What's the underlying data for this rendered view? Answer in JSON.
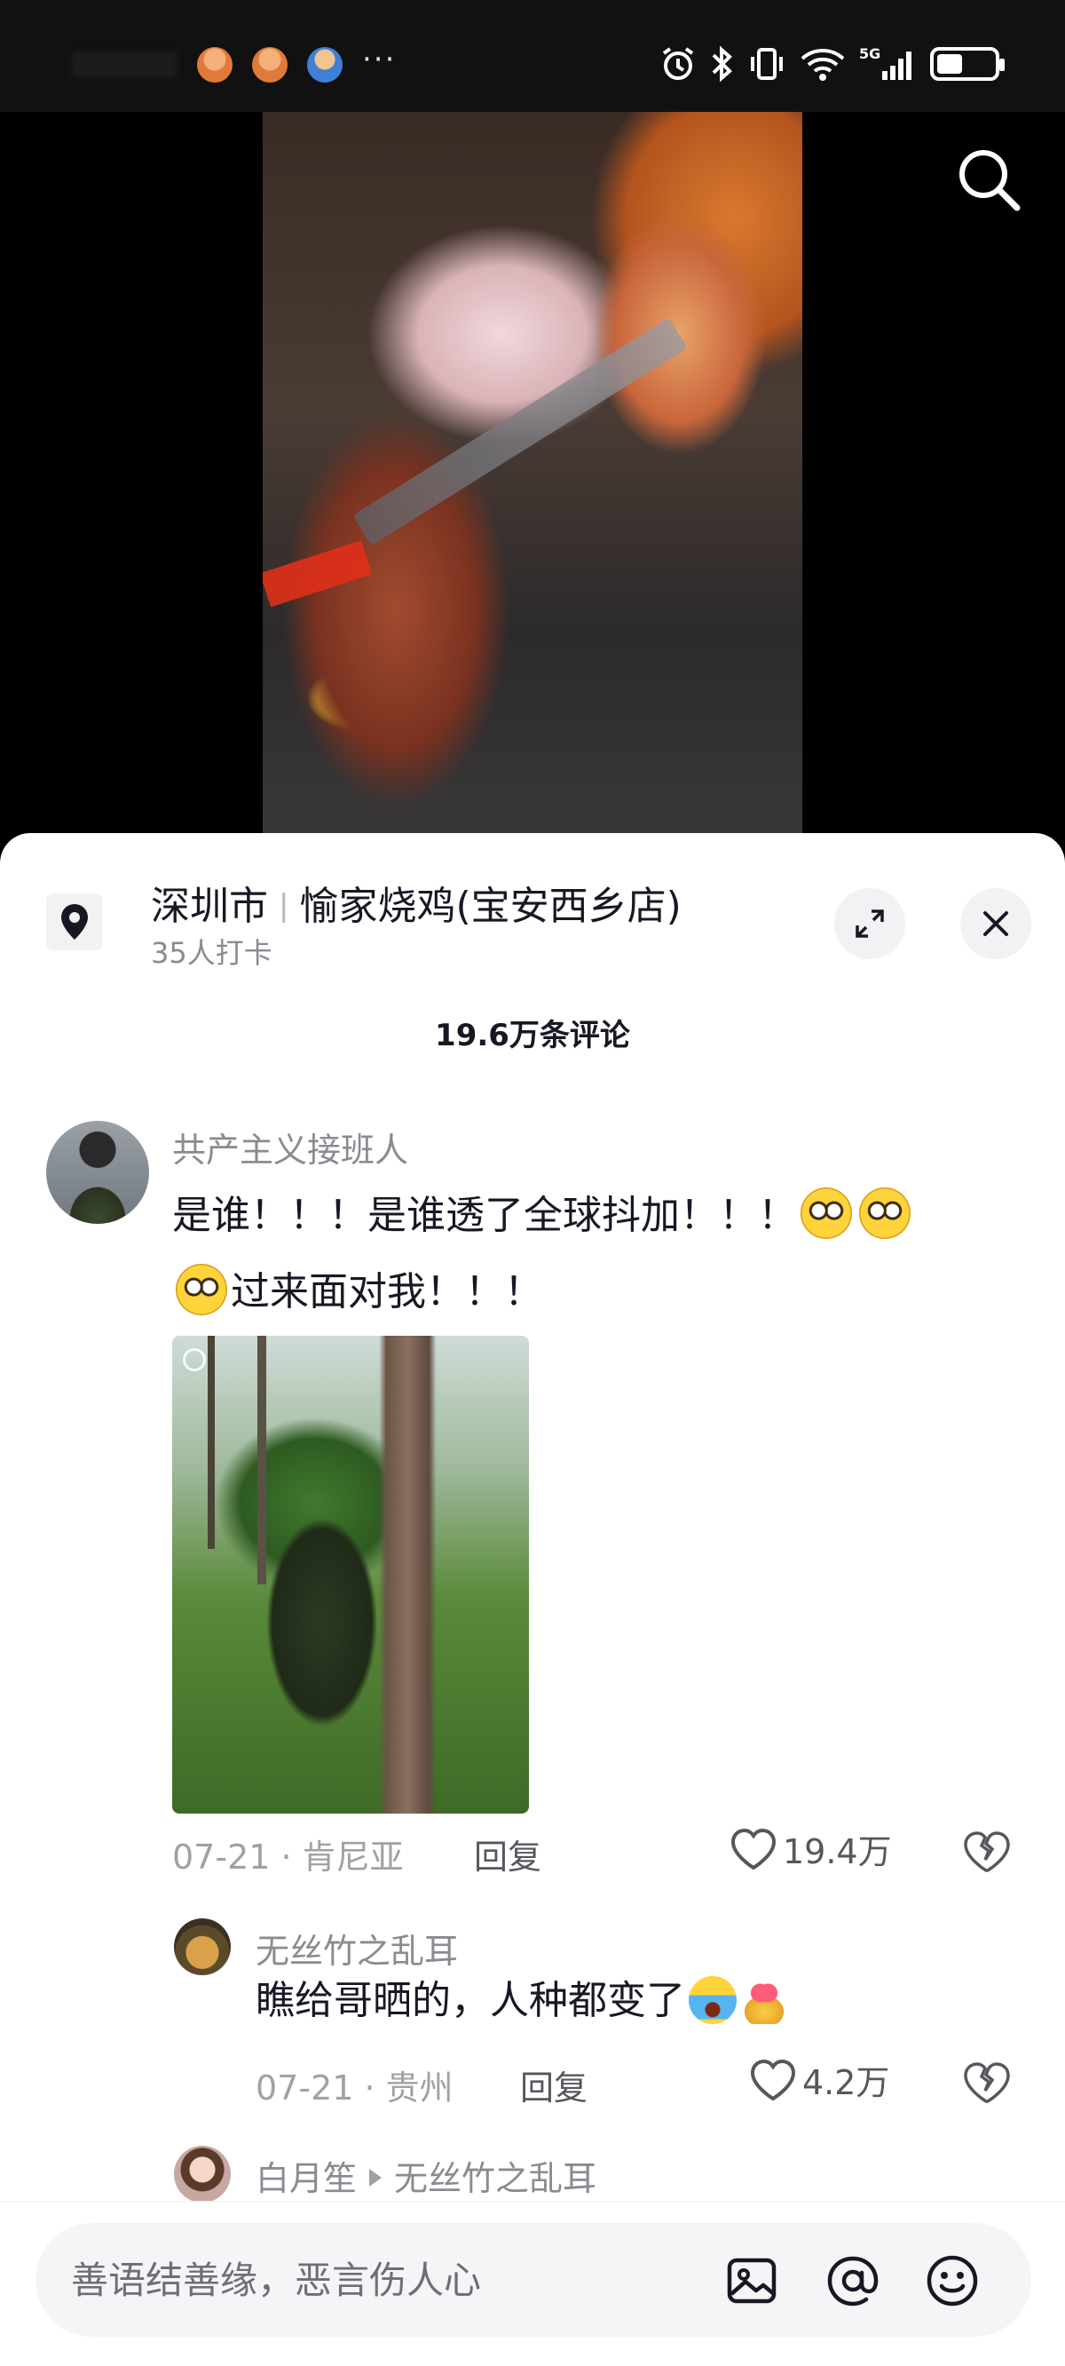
{
  "status_bar": {
    "network": "5G",
    "battery_level": 0.45
  },
  "video": {
    "search_icon": "search-icon"
  },
  "poi": {
    "city": "深圳市",
    "shop_name": "愉家烧鸡(宝安西乡店)",
    "checkins": "35人打卡"
  },
  "comments_header": {
    "count_label": "19.6万条评论"
  },
  "comments": [
    {
      "user": "共产主义接班人",
      "text_line1": "是谁！！！是谁透了全球抖加！！！",
      "text_line2": "过来面对我！！！",
      "date_location": "07-21 · 肯尼亚",
      "reply_label": "回复",
      "likes": "19.4万"
    },
    {
      "user": "无丝竹之乱耳",
      "text": "瞧给哥晒的，人种都变了",
      "date_location": "07-21 · 贵州",
      "reply_label": "回复",
      "likes": "4.2万"
    },
    {
      "user": "白月笙",
      "reply_to": "无丝竹之乱耳"
    }
  ],
  "input_bar": {
    "placeholder": "善语结善缘，恶言伤人心"
  },
  "colors": {
    "primary_text": "#161823",
    "secondary_text": "#8a8b91",
    "sheet_bg": "#ffffff",
    "video_bg": "#000000"
  }
}
